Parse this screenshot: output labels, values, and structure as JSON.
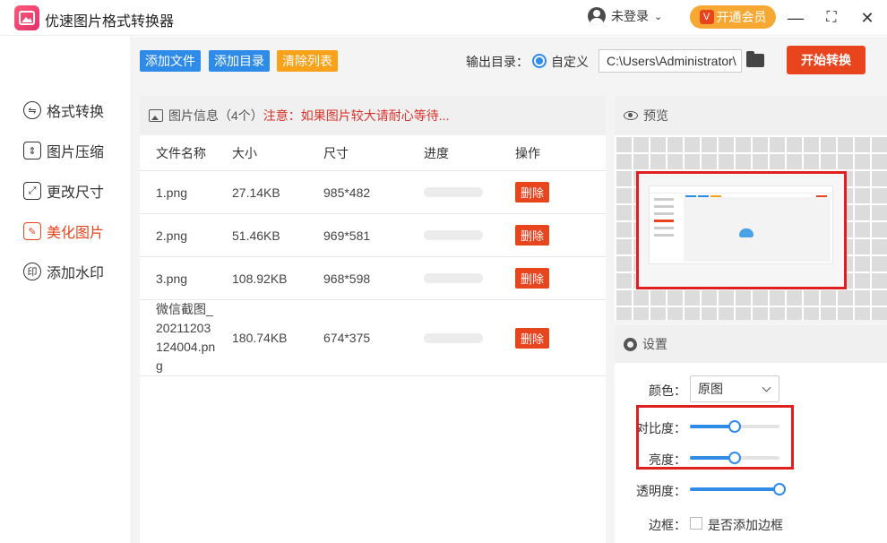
{
  "app": {
    "title": "优速图片格式转换器",
    "user_label": "未登录",
    "vip_badge": "V",
    "vip_label": "开通会员",
    "minimize": "—",
    "maximize": "⛶",
    "close": "✕"
  },
  "sidebar": {
    "items": [
      {
        "label": "格式转换",
        "icon": "swap-icon"
      },
      {
        "label": "图片压缩",
        "icon": "compress-icon"
      },
      {
        "label": "更改尺寸",
        "icon": "resize-icon"
      },
      {
        "label": "美化图片",
        "icon": "beautify-icon",
        "active": true
      },
      {
        "label": "添加水印",
        "icon": "watermark-icon"
      }
    ]
  },
  "toolbar": {
    "add_file": "添加文件",
    "add_dir": "添加目录",
    "clear_list": "清除列表",
    "output_label": "输出目录：",
    "radio_label": "自定义",
    "output_path": "C:\\Users\\Administrator\\",
    "start": "开始转换"
  },
  "file_panel": {
    "header_title": "图片信息（4个）",
    "header_warning": "注意：如果图片较大请耐心等待...",
    "columns": [
      "文件名称",
      "大小",
      "尺寸",
      "进度",
      "操作"
    ],
    "delete_label": "删除",
    "rows": [
      {
        "name": "1.png",
        "size": "27.14KB",
        "dims": "985*482",
        "progress": 0
      },
      {
        "name": "2.png",
        "size": "51.46KB",
        "dims": "969*581",
        "progress": 0
      },
      {
        "name": "3.png",
        "size": "108.92KB",
        "dims": "968*598",
        "progress": 0
      },
      {
        "name": "微信截图_\n20211203\n124004.pn\ng",
        "size": "180.74KB",
        "dims": "674*375",
        "progress": 0
      }
    ]
  },
  "preview": {
    "title": "预览"
  },
  "settings": {
    "title": "设置",
    "color_label": "颜色：",
    "color_value": "原图",
    "contrast_label": "对比度：",
    "contrast_value": 0.5,
    "brightness_label": "亮度：",
    "brightness_value": 0.5,
    "opacity_label": "透明度：",
    "opacity_value": 1.0,
    "border_label": "边框：",
    "border_checkbox_label": "是否添加边框",
    "border_checked": false
  },
  "colors": {
    "accent_blue": "#2e8be8",
    "accent_red": "#e8441d",
    "orange": "#f7a21a",
    "vip_orange": "#f7a833",
    "highlight_red": "#e02020"
  }
}
